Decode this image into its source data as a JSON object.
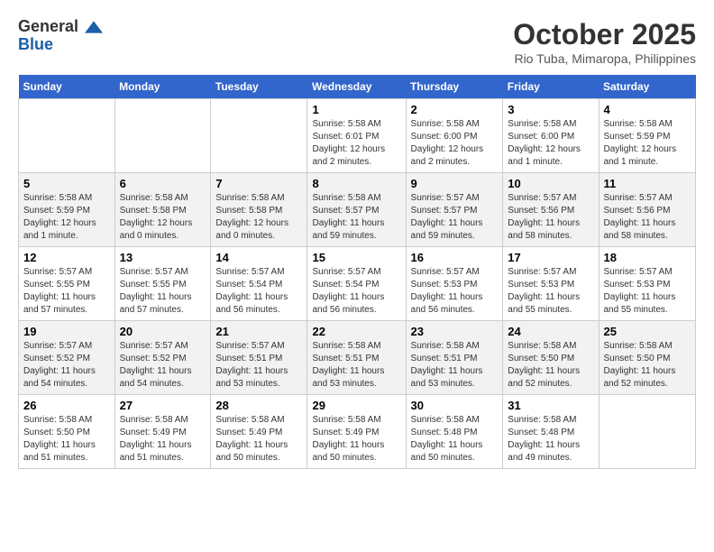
{
  "header": {
    "logo_general": "General",
    "logo_blue": "Blue",
    "month_title": "October 2025",
    "location": "Rio Tuba, Mimaropa, Philippines"
  },
  "columns": [
    "Sunday",
    "Monday",
    "Tuesday",
    "Wednesday",
    "Thursday",
    "Friday",
    "Saturday"
  ],
  "weeks": [
    [
      {
        "day": "",
        "info": ""
      },
      {
        "day": "",
        "info": ""
      },
      {
        "day": "",
        "info": ""
      },
      {
        "day": "1",
        "info": "Sunrise: 5:58 AM\nSunset: 6:01 PM\nDaylight: 12 hours and 2 minutes."
      },
      {
        "day": "2",
        "info": "Sunrise: 5:58 AM\nSunset: 6:00 PM\nDaylight: 12 hours and 2 minutes."
      },
      {
        "day": "3",
        "info": "Sunrise: 5:58 AM\nSunset: 6:00 PM\nDaylight: 12 hours and 1 minute."
      },
      {
        "day": "4",
        "info": "Sunrise: 5:58 AM\nSunset: 5:59 PM\nDaylight: 12 hours and 1 minute."
      }
    ],
    [
      {
        "day": "5",
        "info": "Sunrise: 5:58 AM\nSunset: 5:59 PM\nDaylight: 12 hours and 1 minute."
      },
      {
        "day": "6",
        "info": "Sunrise: 5:58 AM\nSunset: 5:58 PM\nDaylight: 12 hours and 0 minutes."
      },
      {
        "day": "7",
        "info": "Sunrise: 5:58 AM\nSunset: 5:58 PM\nDaylight: 12 hours and 0 minutes."
      },
      {
        "day": "8",
        "info": "Sunrise: 5:58 AM\nSunset: 5:57 PM\nDaylight: 11 hours and 59 minutes."
      },
      {
        "day": "9",
        "info": "Sunrise: 5:57 AM\nSunset: 5:57 PM\nDaylight: 11 hours and 59 minutes."
      },
      {
        "day": "10",
        "info": "Sunrise: 5:57 AM\nSunset: 5:56 PM\nDaylight: 11 hours and 58 minutes."
      },
      {
        "day": "11",
        "info": "Sunrise: 5:57 AM\nSunset: 5:56 PM\nDaylight: 11 hours and 58 minutes."
      }
    ],
    [
      {
        "day": "12",
        "info": "Sunrise: 5:57 AM\nSunset: 5:55 PM\nDaylight: 11 hours and 57 minutes."
      },
      {
        "day": "13",
        "info": "Sunrise: 5:57 AM\nSunset: 5:55 PM\nDaylight: 11 hours and 57 minutes."
      },
      {
        "day": "14",
        "info": "Sunrise: 5:57 AM\nSunset: 5:54 PM\nDaylight: 11 hours and 56 minutes."
      },
      {
        "day": "15",
        "info": "Sunrise: 5:57 AM\nSunset: 5:54 PM\nDaylight: 11 hours and 56 minutes."
      },
      {
        "day": "16",
        "info": "Sunrise: 5:57 AM\nSunset: 5:53 PM\nDaylight: 11 hours and 56 minutes."
      },
      {
        "day": "17",
        "info": "Sunrise: 5:57 AM\nSunset: 5:53 PM\nDaylight: 11 hours and 55 minutes."
      },
      {
        "day": "18",
        "info": "Sunrise: 5:57 AM\nSunset: 5:53 PM\nDaylight: 11 hours and 55 minutes."
      }
    ],
    [
      {
        "day": "19",
        "info": "Sunrise: 5:57 AM\nSunset: 5:52 PM\nDaylight: 11 hours and 54 minutes."
      },
      {
        "day": "20",
        "info": "Sunrise: 5:57 AM\nSunset: 5:52 PM\nDaylight: 11 hours and 54 minutes."
      },
      {
        "day": "21",
        "info": "Sunrise: 5:57 AM\nSunset: 5:51 PM\nDaylight: 11 hours and 53 minutes."
      },
      {
        "day": "22",
        "info": "Sunrise: 5:58 AM\nSunset: 5:51 PM\nDaylight: 11 hours and 53 minutes."
      },
      {
        "day": "23",
        "info": "Sunrise: 5:58 AM\nSunset: 5:51 PM\nDaylight: 11 hours and 53 minutes."
      },
      {
        "day": "24",
        "info": "Sunrise: 5:58 AM\nSunset: 5:50 PM\nDaylight: 11 hours and 52 minutes."
      },
      {
        "day": "25",
        "info": "Sunrise: 5:58 AM\nSunset: 5:50 PM\nDaylight: 11 hours and 52 minutes."
      }
    ],
    [
      {
        "day": "26",
        "info": "Sunrise: 5:58 AM\nSunset: 5:50 PM\nDaylight: 11 hours and 51 minutes."
      },
      {
        "day": "27",
        "info": "Sunrise: 5:58 AM\nSunset: 5:49 PM\nDaylight: 11 hours and 51 minutes."
      },
      {
        "day": "28",
        "info": "Sunrise: 5:58 AM\nSunset: 5:49 PM\nDaylight: 11 hours and 50 minutes."
      },
      {
        "day": "29",
        "info": "Sunrise: 5:58 AM\nSunset: 5:49 PM\nDaylight: 11 hours and 50 minutes."
      },
      {
        "day": "30",
        "info": "Sunrise: 5:58 AM\nSunset: 5:48 PM\nDaylight: 11 hours and 50 minutes."
      },
      {
        "day": "31",
        "info": "Sunrise: 5:58 AM\nSunset: 5:48 PM\nDaylight: 11 hours and 49 minutes."
      },
      {
        "day": "",
        "info": ""
      }
    ]
  ]
}
